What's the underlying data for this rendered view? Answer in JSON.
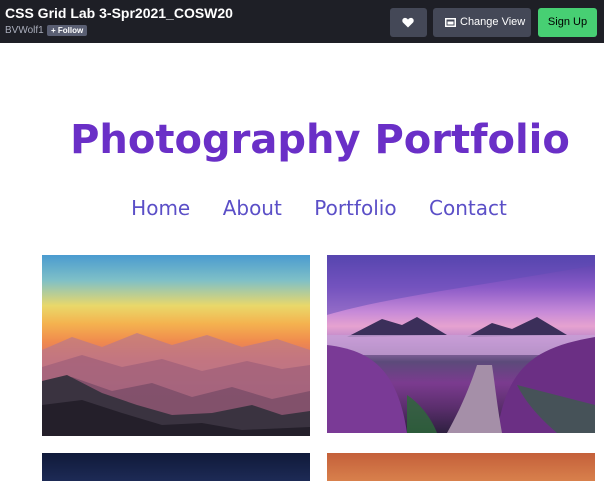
{
  "topbar": {
    "pen_title": "CSS Grid Lab 3-Spr2021_COSW20",
    "author": "BVWolf1",
    "follow_label": "+ Follow",
    "heart_icon": "heart-icon",
    "change_view_label": "Change View",
    "change_view_icon": "layout-icon",
    "signup_label": "Sign Up",
    "signup_color": "#47cf73"
  },
  "page": {
    "title": "Photography Portfolio",
    "title_color": "#6a2fc7",
    "nav": [
      "Home",
      "About",
      "Portfolio",
      "Contact"
    ],
    "nav_color": "#5b4fc7"
  },
  "gallery": {
    "photos": [
      "mountain-sunset-photo",
      "lake-lavender-photo",
      "night-sky-photo",
      "orange-sky-photo"
    ]
  }
}
